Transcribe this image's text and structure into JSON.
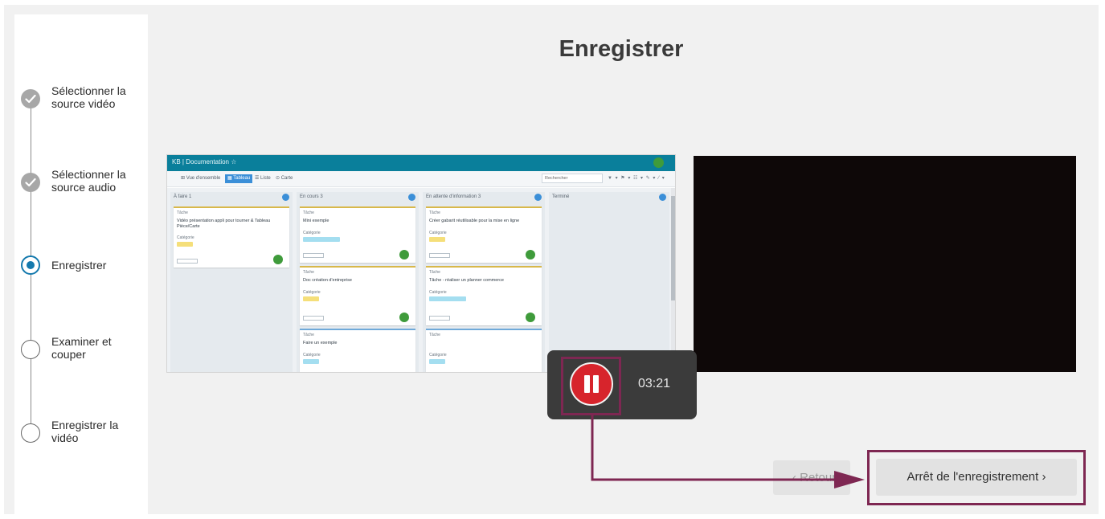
{
  "sidebar": {
    "steps": [
      {
        "label": "Sélectionner la source vidéo",
        "state": "done"
      },
      {
        "label": "Sélectionner la source audio",
        "state": "done"
      },
      {
        "label": "Enregistrer",
        "state": "current"
      },
      {
        "label": "Examiner et couper",
        "state": "todo"
      },
      {
        "label": "Enregistrer la vidéo",
        "state": "todo"
      }
    ]
  },
  "main": {
    "title": "Enregistrer"
  },
  "preview": {
    "app_title": "KB | Documentation ☆",
    "views": [
      "⊞ Vue d'ensemble",
      "▦ Tableau",
      "☰ Liste",
      "⊙ Carte"
    ],
    "search_placeholder": "Rechercher",
    "filters": "▼ ▾  ⚑ ▾  ☷ ▾  ✎ ▾  ⁄ ▾",
    "columns": [
      {
        "name": "À faire  1"
      },
      {
        "name": "En cours  3"
      },
      {
        "name": "En attente d'information  3"
      },
      {
        "name": "Terminé"
      }
    ],
    "cards": [
      {
        "head": "Tâche",
        "text": "Vidéo présentation appli pour tourner & Tableau Pièce/Carte"
      },
      {
        "head": "Tâche",
        "text": "Mini exemple"
      },
      {
        "head": "Tâche",
        "text": "Doc création d'entreprise"
      },
      {
        "head": "Tâche",
        "text": "Faire un exemple"
      },
      {
        "head": "Tâche",
        "text": "Créer gabarit réutilisable pour la mise en ligne"
      },
      {
        "head": "Tâche",
        "text": "Tâche - réaliser un planner commerce"
      },
      {
        "head": "Tâche",
        "text": "Tâche"
      }
    ],
    "category_label": "Catégorie"
  },
  "recorder": {
    "timer": "03:21"
  },
  "buttons": {
    "back_label": "‹  Retour",
    "stop_label": "Arrêt de l'enregistrement  ›"
  },
  "colors": {
    "accent": "#1479ad",
    "record": "#d7242c",
    "annotation": "#7e2752"
  }
}
